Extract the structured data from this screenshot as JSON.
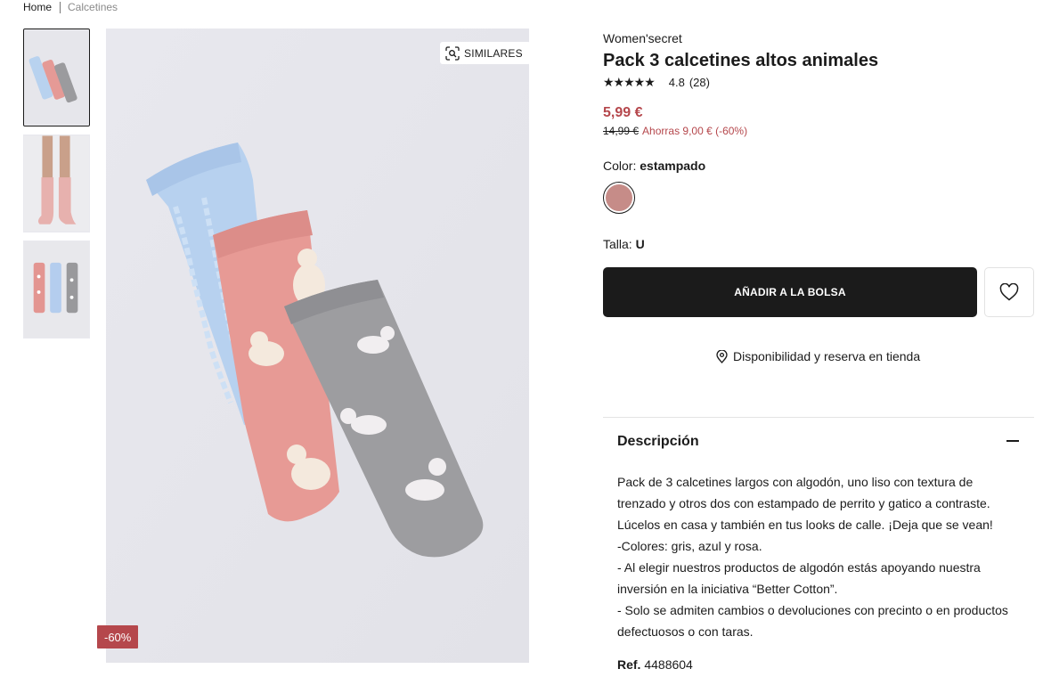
{
  "breadcrumb": {
    "home": "Home",
    "current": "Calcetines"
  },
  "gallery": {
    "thumbnails": [
      "socks-flat-thumb",
      "socks-worn-thumb",
      "socks-row-thumb"
    ],
    "similar_label": "SIMILARES",
    "discount_badge": "-60%"
  },
  "product": {
    "brand": "Women'secret",
    "title": "Pack 3 calcetines altos animales",
    "stars": "★★★★★",
    "rating": "4.8",
    "reviews": "(28)",
    "price": "5,99 €",
    "old_price": "14,99 €",
    "savings": "Ahorras 9,00 € (-60%)",
    "color_label": "Color:",
    "color_value": "estampado",
    "color_hex": "#c68c88",
    "size_label": "Talla:",
    "size_value": "U",
    "add_to_bag": "AÑADIR A LA BOLSA",
    "store_availability": "Disponibilidad y reserva en tienda"
  },
  "description": {
    "heading": "Descripción",
    "lines": [
      "Pack de 3 calcetines largos con algodón, uno liso con textura de",
      "trenzado y otros dos con estampado de perrito y gatico a contraste.",
      "Lúcelos en casa y también en tus looks de calle. ¡Deja que se vean!",
      "-Colores: gris, azul y rosa.",
      "- Al elegir nuestros productos de algodón estás apoyando nuestra",
      "inversión en la iniciativa “Better Cotton”.",
      "- Solo se admiten cambios o devoluciones con precinto o en productos",
      "defectuosos o con taras."
    ],
    "ref_label": "Ref.",
    "ref_value": "4488604"
  },
  "colors": {
    "accent": "#b5474c",
    "button": "#1b1b1b"
  }
}
